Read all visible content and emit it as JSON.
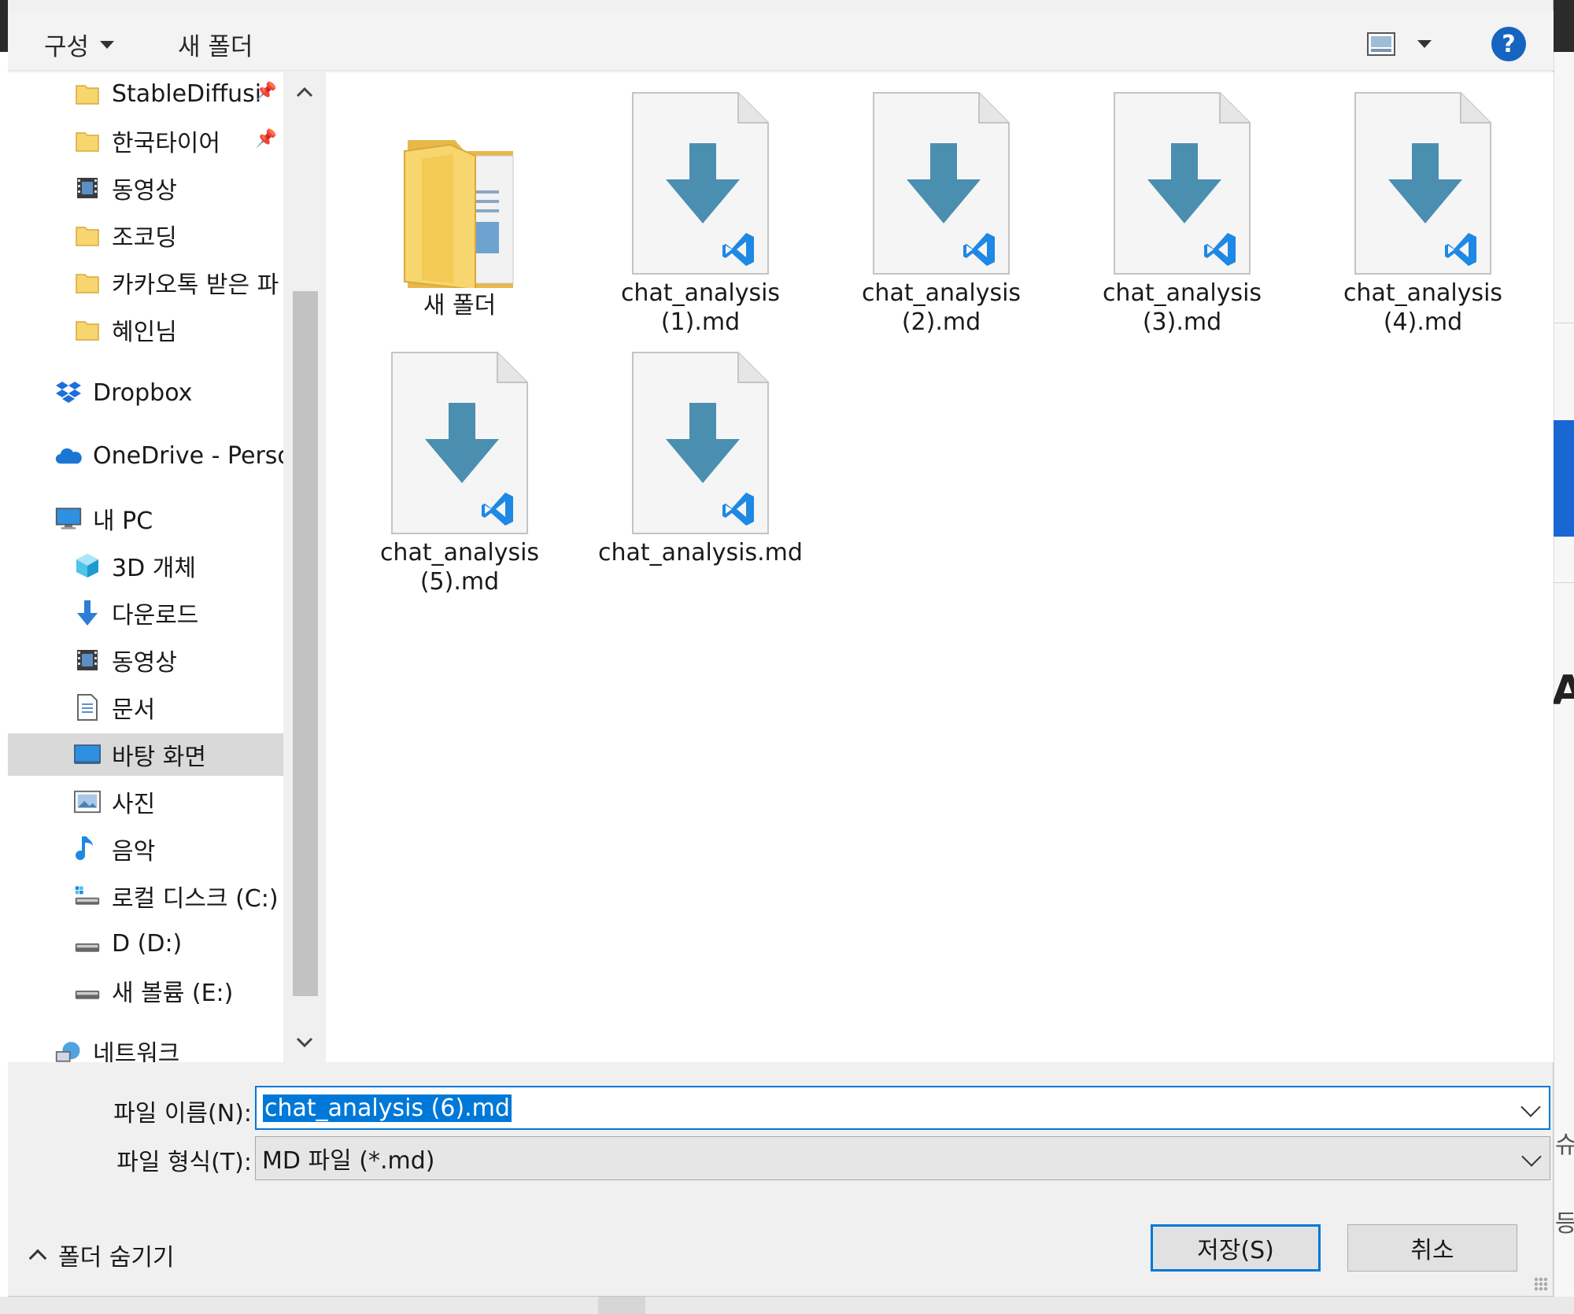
{
  "toolbar": {
    "organize_label": "구성",
    "new_folder_label": "새 폴더",
    "help_label": "?"
  },
  "sidebar": {
    "items": [
      {
        "label": "StableDiffusi",
        "icon": "folder-icon",
        "pinned": true
      },
      {
        "label": "한국타이어",
        "icon": "folder-icon",
        "pinned": true
      },
      {
        "label": "동영상",
        "icon": "video-folder-icon"
      },
      {
        "label": "조코딩",
        "icon": "folder-icon"
      },
      {
        "label": "카카오톡 받은 파",
        "icon": "folder-icon"
      },
      {
        "label": "혜인님",
        "icon": "folder-icon"
      },
      {
        "label": "Dropbox",
        "icon": "dropbox-icon"
      },
      {
        "label": "OneDrive - Person",
        "icon": "onedrive-icon"
      },
      {
        "label": "내 PC",
        "icon": "computer-icon"
      },
      {
        "label": "3D 개체",
        "icon": "3d-objects-icon"
      },
      {
        "label": "다운로드",
        "icon": "download-icon"
      },
      {
        "label": "동영상",
        "icon": "video-folder-icon"
      },
      {
        "label": "문서",
        "icon": "document-icon"
      },
      {
        "label": "바탕 화면",
        "icon": "desktop-icon",
        "selected": true
      },
      {
        "label": "사진",
        "icon": "pictures-icon"
      },
      {
        "label": "음악",
        "icon": "music-icon"
      },
      {
        "label": "로컬 디스크 (C:)",
        "icon": "drive-c-icon"
      },
      {
        "label": "D (D:)",
        "icon": "drive-icon"
      },
      {
        "label": "새 볼륨 (E:)",
        "icon": "drive-icon"
      },
      {
        "label": "네트워크",
        "icon": "network-icon"
      }
    ]
  },
  "files": [
    {
      "name": "새 폴더",
      "kind": "folder"
    },
    {
      "name": "chat_analysis (1).md",
      "line1": "chat_analysis",
      "line2": "(1).md",
      "kind": "md"
    },
    {
      "name": "chat_analysis (2).md",
      "line1": "chat_analysis",
      "line2": "(2).md",
      "kind": "md"
    },
    {
      "name": "chat_analysis (3).md",
      "line1": "chat_analysis",
      "line2": "(3).md",
      "kind": "md"
    },
    {
      "name": "chat_analysis (4).md",
      "line1": "chat_analysis",
      "line2": "(4).md",
      "kind": "md"
    },
    {
      "name": "chat_analysis (5).md",
      "line1": "chat_analysis",
      "line2": "(5).md",
      "kind": "md"
    },
    {
      "name": "chat_analysis.md",
      "line1": "chat_analysis.md",
      "line2": "",
      "kind": "md"
    }
  ],
  "form": {
    "filename_label": "파일 이름(N):",
    "filename_value": "chat_analysis (6).md",
    "filetype_label": "파일 형식(T):",
    "filetype_value": "MD 파일 (*.md)"
  },
  "footer": {
    "hide_folders_label": "폴더 숨기기",
    "save_label": "저장(S)",
    "cancel_label": "취소"
  },
  "background": {
    "peek_letter": "A",
    "peek_text_1": "슈",
    "peek_text_2": "등"
  },
  "colors": {
    "accent": "#0078d7",
    "md_arrow": "#4a8fb0",
    "vscode_blue": "#1e88e5",
    "folder_yellow": "#f7d66f"
  }
}
